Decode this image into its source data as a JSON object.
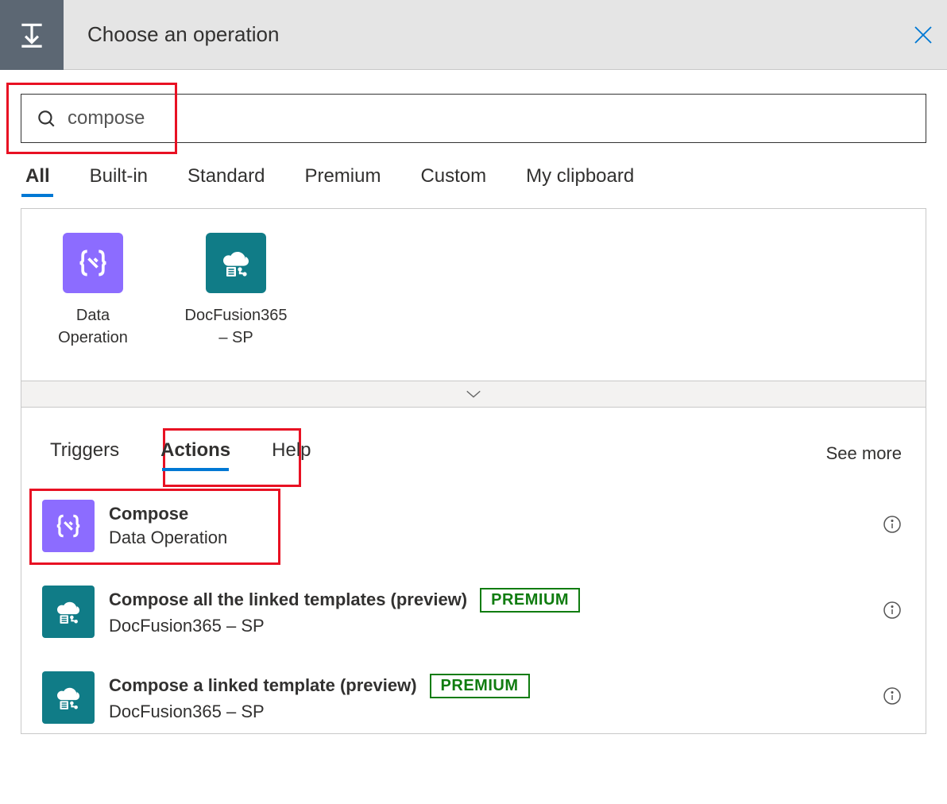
{
  "header": {
    "title": "Choose an operation"
  },
  "search": {
    "value": "compose"
  },
  "filterTabs": [
    {
      "label": "All",
      "active": true
    },
    {
      "label": "Built-in",
      "active": false
    },
    {
      "label": "Standard",
      "active": false
    },
    {
      "label": "Premium",
      "active": false
    },
    {
      "label": "Custom",
      "active": false
    },
    {
      "label": "My clipboard",
      "active": false
    }
  ],
  "connectors": [
    {
      "label": "Data Operation",
      "iconColor": "purple",
      "iconType": "braces"
    },
    {
      "label": "DocFusion365 – SP",
      "iconColor": "teal",
      "iconType": "cloud-doc"
    }
  ],
  "subTabs": {
    "triggers": "Triggers",
    "actions": "Actions",
    "help": "Help",
    "seeMore": "See more"
  },
  "actions": [
    {
      "title": "Compose",
      "subtitle": "Data Operation",
      "iconColor": "purple",
      "iconType": "braces",
      "premium": false
    },
    {
      "title": "Compose all the linked templates (preview)",
      "subtitle": "DocFusion365 – SP",
      "iconColor": "teal",
      "iconType": "cloud-doc",
      "premium": true,
      "premiumLabel": "PREMIUM"
    },
    {
      "title": "Compose a linked template (preview)",
      "subtitle": "DocFusion365 – SP",
      "iconColor": "teal",
      "iconType": "cloud-doc",
      "premium": true,
      "premiumLabel": "PREMIUM"
    }
  ]
}
